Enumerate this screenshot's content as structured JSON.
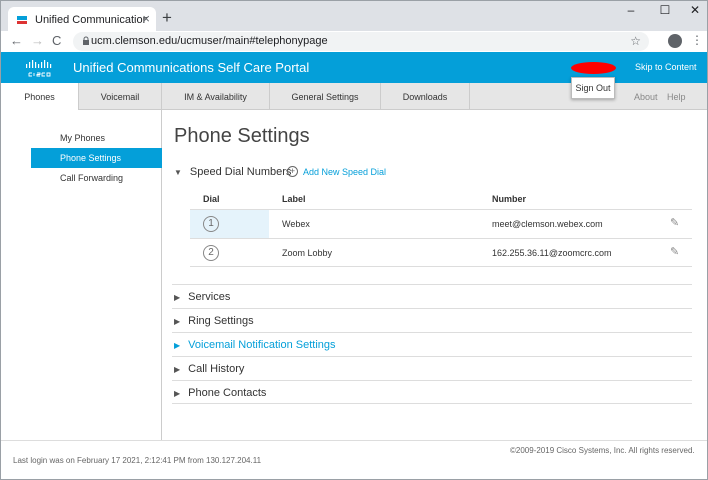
{
  "browser": {
    "tab_title": "Unified Communications Self Care",
    "tab_close": "×",
    "new_tab": "+",
    "win_min": "–",
    "win_max": "☐",
    "win_close": "✕",
    "back": "←",
    "forward": "→",
    "reload": "C",
    "url": "ucm.clemson.edu/ucmuser/main#telephonypage",
    "star": "☆",
    "menu": "⋮"
  },
  "header": {
    "portal_title": "Unified Communications Self Care Portal",
    "skip_link": "Skip to Content",
    "sign_out": "Sign Out"
  },
  "nav": {
    "tabs": [
      {
        "label": "Phones"
      },
      {
        "label": "Voicemail"
      },
      {
        "label": "IM & Availability"
      },
      {
        "label": "General Settings"
      },
      {
        "label": "Downloads"
      }
    ],
    "about": "About",
    "help": "Help"
  },
  "sidebar": {
    "items": [
      {
        "label": "My Phones"
      },
      {
        "label": "Phone Settings"
      },
      {
        "label": "Call Forwarding"
      }
    ]
  },
  "main": {
    "title": "Phone Settings",
    "speed_dial": {
      "heading": "Speed Dial Numbers",
      "add_label": "Add New Speed Dial",
      "columns": {
        "dial": "Dial",
        "label": "Label",
        "number": "Number"
      },
      "rows": [
        {
          "dial": "1",
          "label": "Webex",
          "number": "meet@clemson.webex.com"
        },
        {
          "dial": "2",
          "label": "Zoom Lobby",
          "number": "162.255.36.11@zoomcrc.com"
        }
      ]
    },
    "sections": [
      {
        "label": "Services"
      },
      {
        "label": "Ring Settings"
      },
      {
        "label": "Voicemail Notification Settings"
      },
      {
        "label": "Call History"
      },
      {
        "label": "Phone Contacts"
      }
    ]
  },
  "footer": {
    "copyright": "©2009-2019 Cisco Systems, Inc. All rights reserved.",
    "last_login": "Last login was on February 17 2021, 2:12:41 PM from 130.127.204.11"
  },
  "colors": {
    "cisco_blue": "#049fd9",
    "nav_bg": "#e6e6e6"
  }
}
